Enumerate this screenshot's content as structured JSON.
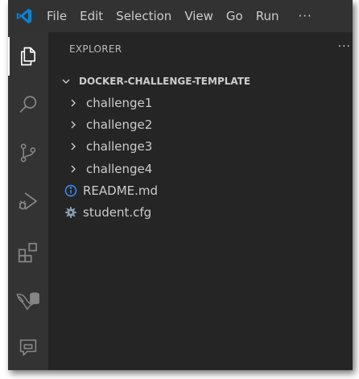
{
  "menu": {
    "items": [
      "File",
      "Edit",
      "Selection",
      "View",
      "Go",
      "Run"
    ],
    "more": "···"
  },
  "activity_bar": [
    "explorer",
    "search",
    "source-control",
    "run-and-debug",
    "extensions",
    "database",
    "remote-explorer"
  ],
  "sidebar": {
    "title": "EXPLORER",
    "more": "···",
    "section_title": "DOCKER-CHALLENGE-TEMPLATE",
    "items": [
      {
        "label": "challenge1",
        "type": "folder"
      },
      {
        "label": "challenge2",
        "type": "folder"
      },
      {
        "label": "challenge3",
        "type": "folder"
      },
      {
        "label": "challenge4",
        "type": "folder"
      },
      {
        "label": "README.md",
        "type": "info-file"
      },
      {
        "label": "student.cfg",
        "type": "gear-file"
      }
    ]
  },
  "colors": {
    "accent": "#0078d4",
    "info": "#3794ff",
    "sidebar_bg": "#252526",
    "activity_bg": "#333333",
    "titlebar_bg": "#323233"
  }
}
